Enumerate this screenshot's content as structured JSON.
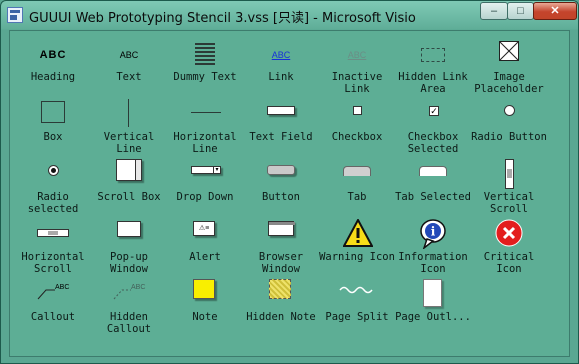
{
  "window": {
    "title": "GUUUI Web Prototyping Stencil 3.vss  [只读] - Microsoft Visio",
    "buttons": {
      "minimize": "–",
      "maximize": "□",
      "close": "✕"
    }
  },
  "stencil": {
    "items": [
      {
        "label": "Heading",
        "icon": "heading-icon",
        "sample": "ABC"
      },
      {
        "label": "Text",
        "icon": "text-icon",
        "sample": "ABC"
      },
      {
        "label": "Dummy Text",
        "icon": "dummy-text-icon"
      },
      {
        "label": "Link",
        "icon": "link-icon",
        "sample": "ABC"
      },
      {
        "label": "Inactive\nLink",
        "icon": "inactive-link-icon",
        "sample": "ABC"
      },
      {
        "label": "Hidden Link\nArea",
        "icon": "hidden-link-area-icon"
      },
      {
        "label": "Image\nPlaceholder",
        "icon": "image-placeholder-icon"
      },
      {
        "label": "Box",
        "icon": "box-icon"
      },
      {
        "label": "Vertical\nLine",
        "icon": "vertical-line-icon"
      },
      {
        "label": "Horizontal\nLine",
        "icon": "horizontal-line-icon"
      },
      {
        "label": "Text Field",
        "icon": "text-field-icon"
      },
      {
        "label": "Checkbox",
        "icon": "checkbox-icon"
      },
      {
        "label": "Checkbox\nSelected",
        "icon": "checkbox-selected-icon"
      },
      {
        "label": "Radio Button",
        "icon": "radio-button-icon"
      },
      {
        "label": "Radio\nselected",
        "icon": "radio-selected-icon"
      },
      {
        "label": "Scroll Box",
        "icon": "scroll-box-icon"
      },
      {
        "label": "Drop Down",
        "icon": "drop-down-icon"
      },
      {
        "label": "Button",
        "icon": "button-icon"
      },
      {
        "label": "Tab",
        "icon": "tab-icon"
      },
      {
        "label": "Tab Selected",
        "icon": "tab-selected-icon"
      },
      {
        "label": "Vertical\nScroll",
        "icon": "vertical-scroll-icon"
      },
      {
        "label": "Horizontal\nScroll",
        "icon": "horizontal-scroll-icon"
      },
      {
        "label": "Pop-up\nWindow",
        "icon": "popup-window-icon"
      },
      {
        "label": "Alert",
        "icon": "alert-icon"
      },
      {
        "label": "Browser\nWindow",
        "icon": "browser-window-icon"
      },
      {
        "label": "Warning Icon",
        "icon": "warning-icon"
      },
      {
        "label": "Information\nIcon",
        "icon": "information-icon"
      },
      {
        "label": "Critical\nIcon",
        "icon": "critical-icon"
      },
      {
        "label": "Callout",
        "icon": "callout-icon",
        "sample": "ABC"
      },
      {
        "label": "Hidden\nCallout",
        "icon": "hidden-callout-icon",
        "sample": "ABC"
      },
      {
        "label": "Note",
        "icon": "note-icon"
      },
      {
        "label": "Hidden Note",
        "icon": "hidden-note-icon"
      },
      {
        "label": "Page Split",
        "icon": "page-split-icon"
      },
      {
        "label": "Page Outl...",
        "icon": "page-outline-icon"
      }
    ]
  }
}
